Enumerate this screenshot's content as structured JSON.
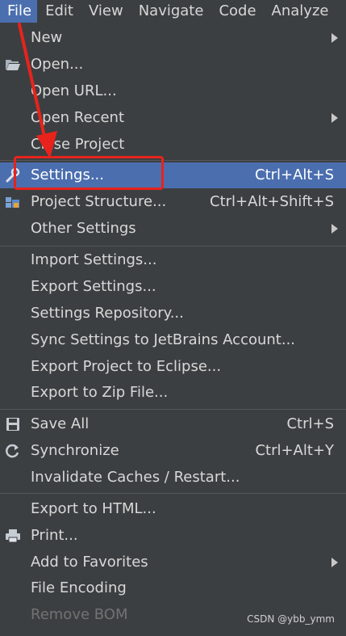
{
  "menubar": {
    "items": [
      "File",
      "Edit",
      "View",
      "Navigate",
      "Code",
      "Analyze"
    ]
  },
  "menu": {
    "new": "New",
    "open": "Open...",
    "open_url": "Open URL...",
    "open_recent": "Open Recent",
    "close_project": "Close Project",
    "settings": "Settings...",
    "settings_shortcut": "Ctrl+Alt+S",
    "project_structure": "Project Structure...",
    "project_structure_shortcut": "Ctrl+Alt+Shift+S",
    "other_settings": "Other Settings",
    "import_settings": "Import Settings...",
    "export_settings": "Export Settings...",
    "settings_repository": "Settings Repository...",
    "sync_settings": "Sync Settings to JetBrains Account...",
    "export_eclipse": "Export Project to Eclipse...",
    "export_zip": "Export to Zip File...",
    "save_all": "Save All",
    "save_all_shortcut": "Ctrl+S",
    "synchronize": "Synchronize",
    "synchronize_shortcut": "Ctrl+Alt+Y",
    "invalidate_caches": "Invalidate Caches / Restart...",
    "export_html": "Export to HTML...",
    "print": "Print...",
    "add_favorites": "Add to Favorites",
    "file_encoding": "File Encoding",
    "remove_bom": "Remove BOM"
  },
  "watermark": "CSDN @ybb_ymm",
  "colors": {
    "background": "#3c3f41",
    "selection": "#4b6eaf",
    "annotation_red": "#e8231b"
  }
}
